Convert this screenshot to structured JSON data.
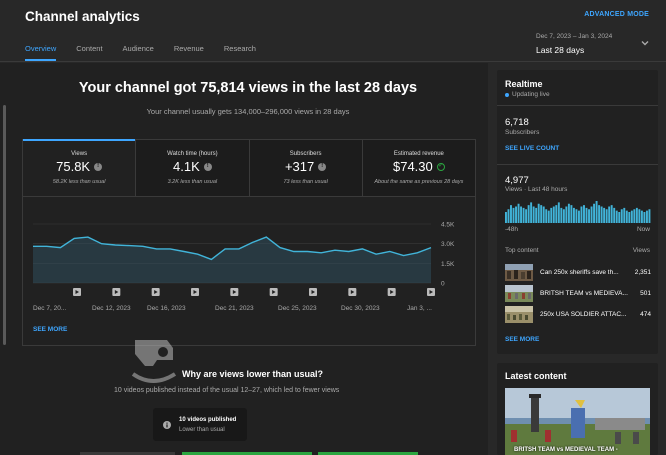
{
  "header": {
    "title": "Channel analytics",
    "advanced_mode": "ADVANCED MODE",
    "tabs": [
      {
        "label": "Overview",
        "active": true
      },
      {
        "label": "Content",
        "active": false
      },
      {
        "label": "Audience",
        "active": false
      },
      {
        "label": "Revenue",
        "active": false
      },
      {
        "label": "Research",
        "active": false
      }
    ],
    "date_range": {
      "sub": "Dec 7, 2023 – Jan 3, 2024",
      "main": "Last 28 days"
    }
  },
  "overview": {
    "headline": "Your channel got 75,814 views in the last 28 days",
    "subline": "Your channel usually gets 134,000–296,000 views in 28 days",
    "metrics": [
      {
        "label": "Views",
        "value": "75.8K",
        "note": "58.2K less than usual",
        "status": "below"
      },
      {
        "label": "Watch time (hours)",
        "value": "4.1K",
        "note": "3.2K less than usual",
        "status": "below"
      },
      {
        "label": "Subscribers",
        "value": "+317",
        "note": "73 less than usual",
        "status": "below"
      },
      {
        "label": "Estimated revenue",
        "value": "$74.30",
        "note": "About the same as previous 28 days",
        "status": "normal"
      }
    ],
    "see_more": "SEE MORE",
    "why_title": "Why are views lower than usual?",
    "why_desc": "10 videos published instead of the usual 12–27, which led to fewer views",
    "tip": {
      "title": "10 videos published",
      "sub": "Lower than usual"
    }
  },
  "chart_data": {
    "type": "area",
    "x_tick_labels": [
      "Dec 7, 20...",
      "Dec 12, 2023",
      "Dec 16, 2023",
      "Dec 21, 2023",
      "Dec 25, 2023",
      "Dec 30, 2023",
      "Jan 3, ..."
    ],
    "y_tick_labels": [
      "4.5K",
      "3.0K",
      "1.5K",
      "0"
    ],
    "ylim": [
      0,
      4500
    ],
    "values": [
      2800,
      2800,
      2700,
      3400,
      3500,
      3000,
      2900,
      2850,
      2800,
      2600,
      2600,
      2400,
      2200,
      1800,
      2600,
      2600,
      3100,
      3500,
      2700,
      2400,
      2400,
      2300,
      2500,
      2400,
      2600,
      2200,
      2400,
      2100,
      2300,
      2700
    ],
    "series_color": "#41b4d9",
    "video_markers": 10
  },
  "realtime": {
    "title": "Realtime",
    "live": "Updating live",
    "subscribers": "6,718",
    "subscribers_label": "Subscribers",
    "see_live_count": "SEE LIVE COUNT",
    "views": "4,977",
    "views_label": "Views · Last 48 hours",
    "bars": [
      8,
      10,
      13,
      11,
      12,
      14,
      12,
      11,
      10,
      13,
      15,
      12,
      11,
      14,
      13,
      12,
      10,
      9,
      11,
      12,
      13,
      15,
      11,
      10,
      12,
      14,
      13,
      11,
      10,
      9,
      12,
      13,
      11,
      10,
      12,
      14,
      16,
      13,
      12,
      11,
      10,
      12,
      13,
      11,
      9,
      8,
      10,
      11,
      9,
      8,
      9,
      10,
      11,
      10,
      9,
      8,
      9,
      10
    ],
    "axis_left": "-48h",
    "axis_right": "Now",
    "top_content_label": "Top content",
    "views_col_label": "Views",
    "top_content": [
      {
        "title": "Can 250x sheriffs save th...",
        "views": "2,351"
      },
      {
        "title": "BRITSH TEAM vs MEDIEVA...",
        "views": "501"
      },
      {
        "title": "250x USA SOLDIER ATTAC...",
        "views": "474"
      }
    ],
    "see_more": "SEE MORE"
  },
  "latest": {
    "title": "Latest content",
    "caption": "BRITSH TEAM vs MEDIEVAL TEAM -"
  }
}
